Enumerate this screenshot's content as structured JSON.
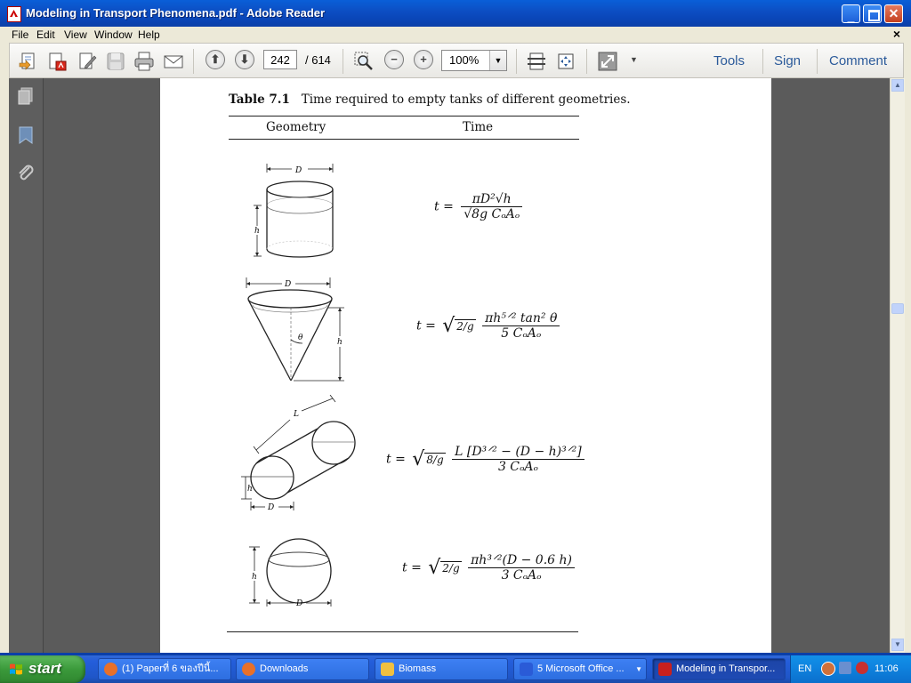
{
  "window": {
    "title": "Modeling in Transport Phenomena.pdf - Adobe Reader"
  },
  "menu": {
    "items": [
      "File",
      "Edit",
      "View",
      "Window",
      "Help"
    ],
    "close_doc": "×"
  },
  "toolbar": {
    "page_current": "242",
    "page_total": "/ 614",
    "zoom": "100%",
    "links": [
      "Tools",
      "Sign",
      "Comment"
    ]
  },
  "document": {
    "caption_label": "Table 7.1",
    "caption_text": "Time required to empty tanks of different geometries.",
    "col_geometry": "Geometry",
    "col_time": "Time",
    "label_D": "D",
    "label_h": "h",
    "label_L": "L",
    "label_theta": "θ",
    "rows": [
      {
        "lhs": "t =",
        "num": "πD²√h",
        "den": "√8g CₒAₒ"
      },
      {
        "lhs": "t =",
        "root": "2/g",
        "num": "πh⁵ᐟ² tan² θ",
        "den": "5 CₒAₒ"
      },
      {
        "lhs": "t =",
        "root": "8/g",
        "num": "L [D³ᐟ² − (D − h)³ᐟ²]",
        "den": "3 CₒAₒ"
      },
      {
        "lhs": "t =",
        "root": "2/g",
        "num": "πh³ᐟ²(D − 0.6 h)",
        "den": "3 CₒAₒ"
      }
    ]
  },
  "taskbar": {
    "start_label": "start",
    "tasks": [
      {
        "label": "(1) Paperที่ 6 ของปีนี้...",
        "icon_color": "#e8702a"
      },
      {
        "label": "Downloads",
        "icon_color": "#e8702a"
      },
      {
        "label": "Biomass",
        "icon_color": "#f0c040"
      },
      {
        "label": "5 Microsoft Office ...",
        "icon_color": "#2a5bd7"
      },
      {
        "label": "Modeling in Transpor...",
        "icon_color": "#c8201e"
      }
    ],
    "lang": "EN",
    "clock": "11:06"
  }
}
